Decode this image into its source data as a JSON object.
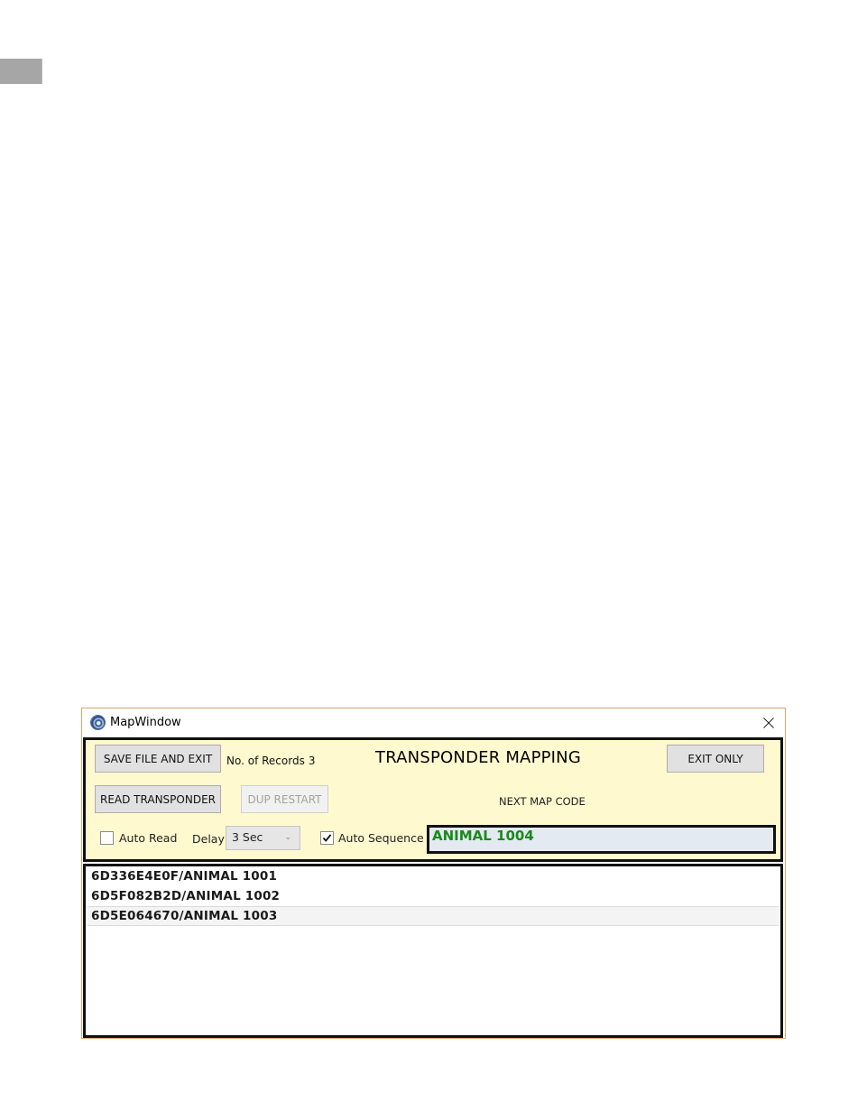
{
  "window": {
    "title": "MapWindow",
    "app_icon": "globe-icon",
    "close_icon": "close-icon"
  },
  "panel": {
    "heading": "TRANSPONDER MAPPING",
    "save_button": "SAVE FILE AND EXIT",
    "records_label": "No. of Records",
    "records_count": "3",
    "exit_button": "EXIT ONLY",
    "read_button": "READ TRANSPONDER",
    "dup_restart_button": "DUP RESTART",
    "next_map_code_label": "NEXT MAP CODE",
    "auto_read": {
      "label": "Auto Read",
      "checked": false
    },
    "delay": {
      "label": "Delay",
      "selected": "3 Sec"
    },
    "auto_sequence": {
      "label": "Auto Sequence",
      "checked": true
    },
    "next_map_code_value": "ANIMAL 1004"
  },
  "records": [
    "6D336E4E0F/ANIMAL 1001",
    "6D5F082B2D/ANIMAL 1002",
    "6D5E064670/ANIMAL 1003"
  ],
  "colors": {
    "panel_bg": "#fff9cf",
    "code_text": "#1a8a1a",
    "code_bg": "#e3eaf2",
    "window_border": "#d8a66a"
  }
}
